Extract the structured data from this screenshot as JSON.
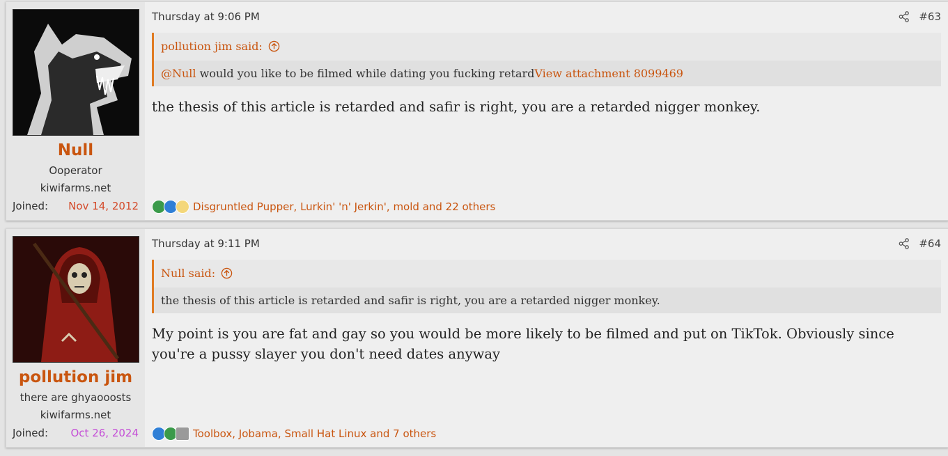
{
  "posts": [
    {
      "username": "Null",
      "user_title": "Ooperator",
      "user_banner": "kiwifarms.net",
      "joined_label": "Joined:",
      "joined_date": "Nov 14, 2012",
      "joined_color": "#d44a2a",
      "timestamp": "Thursday at 9:06 PM",
      "post_number": "#63",
      "quote": {
        "author": "pollution jim said:",
        "mention": "@Null",
        "text": " would you like to be filmed while dating you fucking retard",
        "attachment": "View attachment 8099469"
      },
      "message": "the thesis of this article is retarded and safir is right, you are a retarded nigger monkey.",
      "reactions": "Disgruntled Pupper, Lurkin' 'n' Jerkin', mold and 22 others"
    },
    {
      "username": "pollution jim",
      "user_title": "there are ghyaooosts",
      "user_banner": "kiwifarms.net",
      "joined_label": "Joined:",
      "joined_date": "Oct 26, 2024",
      "joined_color": "#c44fd6",
      "timestamp": "Thursday at 9:11 PM",
      "post_number": "#64",
      "quote": {
        "author": "Null said:",
        "text": "the thesis of this article is retarded and safir is right, you are a retarded nigger monkey."
      },
      "message": "My point is you are fat and gay so you would be more likely to be filmed and put on TikTok. Obviously since you're a pussy slayer you don't need dates anyway",
      "reactions": "Toolbox, Jobama, Small Hat Linux and 7 others"
    }
  ],
  "colors": {
    "accent": "#c9550f",
    "quote_border": "#e07b22"
  }
}
